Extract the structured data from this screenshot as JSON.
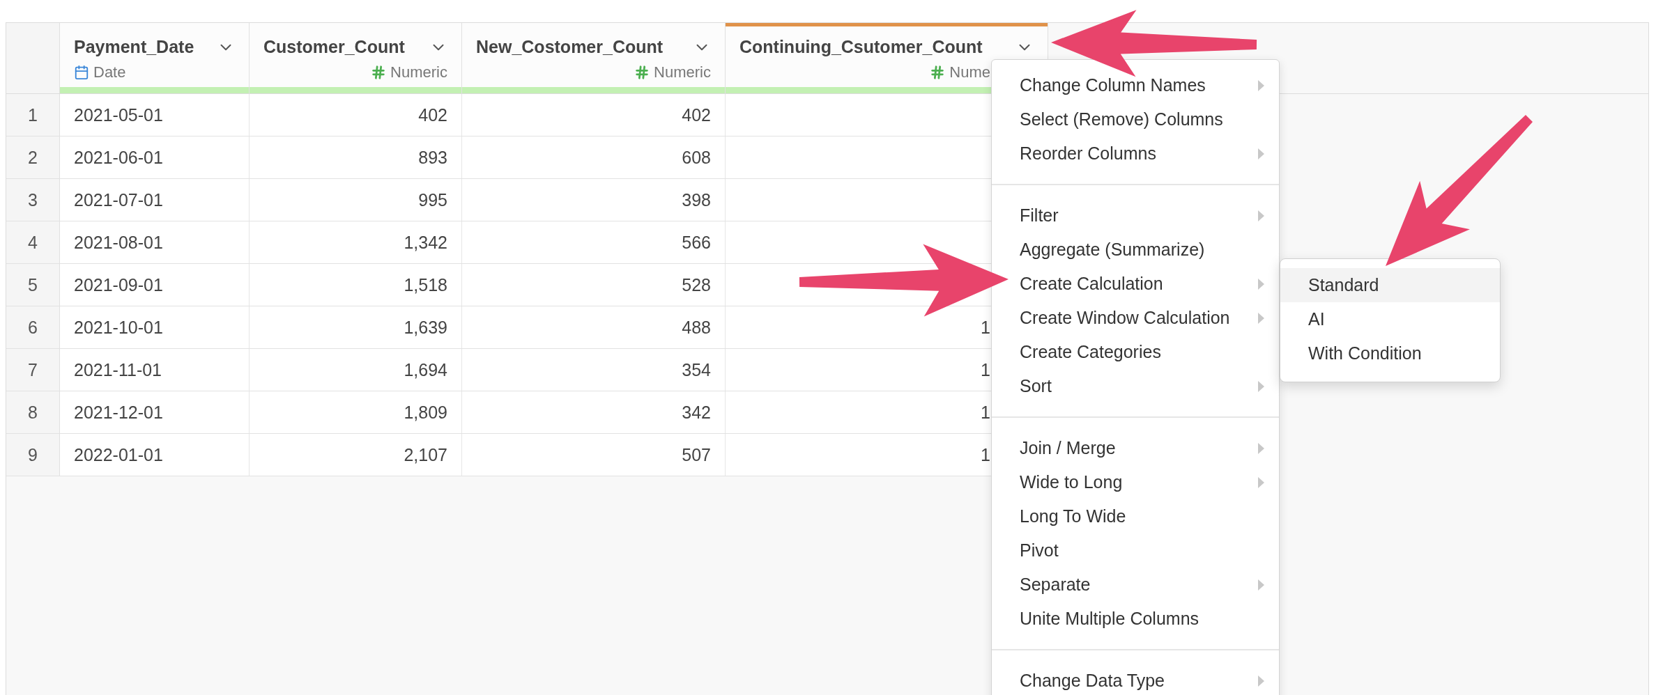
{
  "table": {
    "columns": [
      {
        "name": "Payment_Date",
        "type": "Date",
        "kind": "date",
        "selected": false
      },
      {
        "name": "Customer_Count",
        "type": "Numeric",
        "kind": "numeric",
        "selected": false
      },
      {
        "name": "New_Costomer_Count",
        "type": "Numeric",
        "kind": "numeric",
        "selected": false
      },
      {
        "name": "Continuing_Csutomer_Count",
        "type": "Nume",
        "kind": "numeric",
        "selected": true
      }
    ],
    "rows": [
      {
        "number": "1",
        "cells": [
          "2021-05-01",
          "402",
          "402"
        ]
      },
      {
        "number": "2",
        "cells": [
          "2021-06-01",
          "893",
          "608"
        ]
      },
      {
        "number": "3",
        "cells": [
          "2021-07-01",
          "995",
          "398"
        ]
      },
      {
        "number": "4",
        "cells": [
          "2021-08-01",
          "1,342",
          "566"
        ]
      },
      {
        "number": "5",
        "cells": [
          "2021-09-01",
          "1,518",
          "528"
        ]
      },
      {
        "number": "6",
        "cells": [
          "2021-10-01",
          "1,639",
          "488",
          "1"
        ]
      },
      {
        "number": "7",
        "cells": [
          "2021-11-01",
          "1,694",
          "354",
          "1"
        ]
      },
      {
        "number": "8",
        "cells": [
          "2021-12-01",
          "1,809",
          "342",
          "1"
        ]
      },
      {
        "number": "9",
        "cells": [
          "2022-01-01",
          "2,107",
          "507",
          "1"
        ]
      }
    ]
  },
  "context_menu": {
    "sections": [
      {
        "items": [
          {
            "label": "Change Column Names",
            "submenu": true
          },
          {
            "label": "Select (Remove) Columns",
            "submenu": false
          },
          {
            "label": "Reorder Columns",
            "submenu": true
          }
        ]
      },
      {
        "items": [
          {
            "label": "Filter",
            "submenu": true
          },
          {
            "label": "Aggregate (Summarize)",
            "submenu": false
          },
          {
            "label": "Create Calculation",
            "submenu": true
          },
          {
            "label": "Create Window Calculation",
            "submenu": true
          },
          {
            "label": "Create Categories",
            "submenu": false
          },
          {
            "label": "Sort",
            "submenu": true
          }
        ]
      },
      {
        "items": [
          {
            "label": "Join / Merge",
            "submenu": true
          },
          {
            "label": "Wide to Long",
            "submenu": true
          },
          {
            "label": "Long To Wide",
            "submenu": false
          },
          {
            "label": "Pivot",
            "submenu": false
          },
          {
            "label": "Separate",
            "submenu": true
          },
          {
            "label": "Unite Multiple Columns",
            "submenu": false
          }
        ]
      },
      {
        "items": [
          {
            "label": "Change Data Type",
            "submenu": true
          }
        ]
      }
    ]
  },
  "submenu": {
    "items": [
      {
        "label": "Standard",
        "selected": true
      },
      {
        "label": "AI",
        "selected": false
      },
      {
        "label": "With Condition",
        "selected": false
      }
    ]
  }
}
